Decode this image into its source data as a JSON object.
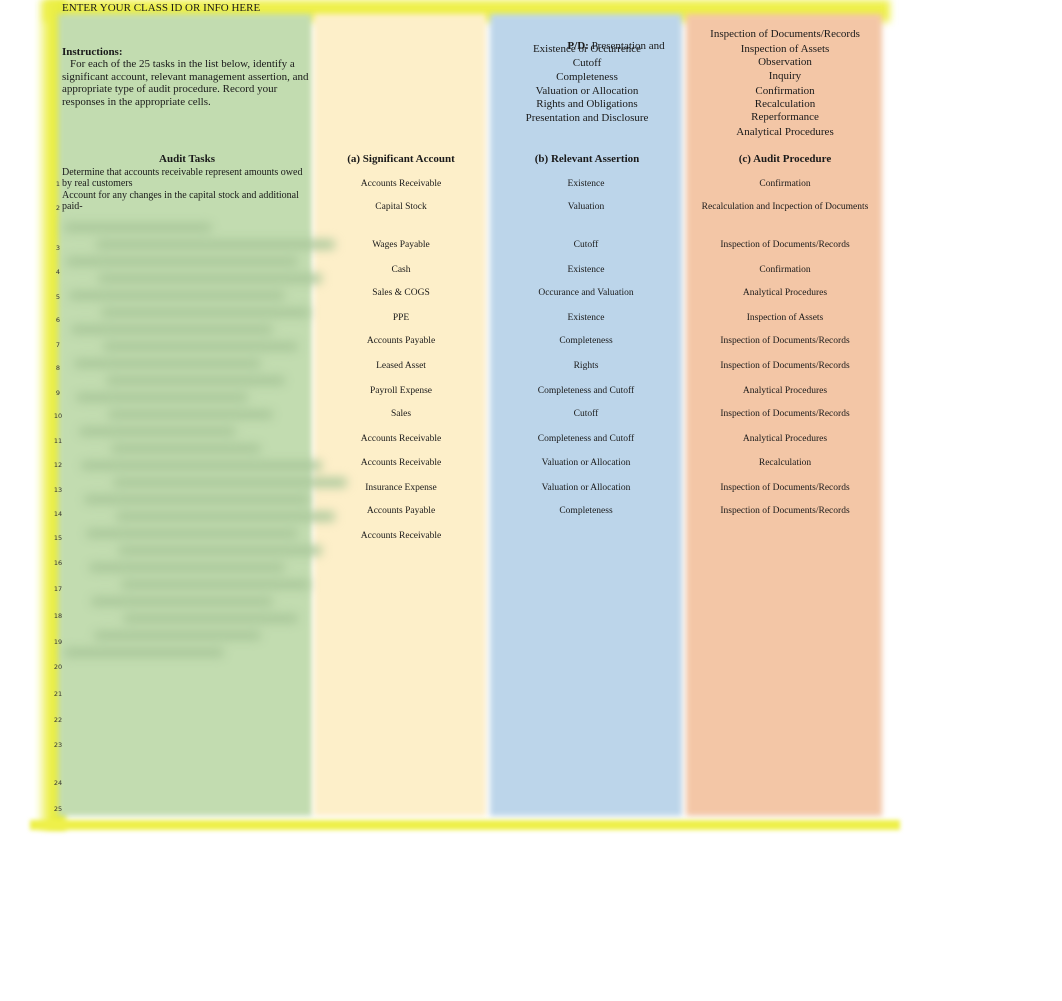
{
  "header": {
    "class_id_prompt": "ENTER YOUR CLASS ID OR INFO HERE"
  },
  "instructions": {
    "title": "Instructions:",
    "body": "For each of the 25 tasks in the list below, identify a significant account, relevant management assertion, and appropriate type of audit procedure. Record your responses in the appropriate cells."
  },
  "assertion_legend": {
    "overlay_label_bold": "P/D:",
    "overlay_label_rest": "Presentation and",
    "items": [
      "Existence or Occurrence",
      "Cutoff",
      "Completeness",
      "Valuation or Allocation",
      "Rights and Obligations",
      "Presentation and Disclosure"
    ]
  },
  "procedure_legend": {
    "items": [
      "Inspection of Documents/Records",
      "Inspection of Assets",
      "Observation",
      "Inquiry",
      "Confirmation",
      "Recalculation",
      "Reperformance",
      "Analytical Procedures"
    ]
  },
  "table": {
    "headers": {
      "tasks": "Audit Tasks",
      "account": "(a) Significant Account",
      "assertion": "(b) Relevant Assertion",
      "procedure": "(c) Audit Procedure"
    },
    "rows": [
      {
        "num": "1",
        "task": "Determine that accounts receivable represent amounts owed by real customers",
        "account": "Accounts Receivable",
        "assertion": "Existence",
        "procedure": "Confirmation"
      },
      {
        "num": "2",
        "task": "Account for any changes in the capital stock and additional paid-",
        "account": "Capital Stock",
        "assertion": "Valuation",
        "procedure": "Recalculation and Incpection of Documents"
      },
      {
        "num": "3",
        "task": "",
        "account": "Wages Payable",
        "assertion": "Cutoff",
        "procedure": "Inspection of Documents/Records"
      },
      {
        "num": "4",
        "task": "",
        "account": "Cash",
        "assertion": "Existence",
        "procedure": "Confirmation"
      },
      {
        "num": "5",
        "task": "",
        "account": "Sales & COGS",
        "assertion": "Occurance and Valuation",
        "procedure": "Analytical Procedures"
      },
      {
        "num": "6",
        "task": "",
        "account": "PPE",
        "assertion": "Existence",
        "procedure": "Inspection of Assets"
      },
      {
        "num": "7",
        "task": "",
        "account": "Accounts Payable",
        "assertion": "Completeness",
        "procedure": "Inspection of Documents/Records"
      },
      {
        "num": "8",
        "task": "",
        "account": "Leased Asset",
        "assertion": "Rights",
        "procedure": "Inspection of Documents/Records"
      },
      {
        "num": "9",
        "task": "",
        "account": "Payroll Expense",
        "assertion": "Completeness and Cutoff",
        "procedure": "Analytical Procedures"
      },
      {
        "num": "10",
        "task": "",
        "account": "Sales",
        "assertion": "Cutoff",
        "procedure": "Inspection of Documents/Records"
      },
      {
        "num": "11",
        "task": "",
        "account": "Accounts Receivable",
        "assertion": "Completeness and Cutoff",
        "procedure": "Analytical Procedures"
      },
      {
        "num": "12",
        "task": "",
        "account": "Accounts Receivable",
        "assertion": "Valuation or Allocation",
        "procedure": "Recalculation"
      },
      {
        "num": "13",
        "task": "",
        "account": "Insurance Expense",
        "assertion": "Valuation or Allocation",
        "procedure": "Inspection of Documents/Records"
      },
      {
        "num": "14",
        "task": "",
        "account": "Accounts Payable",
        "assertion": "Completeness",
        "procedure": "Inspection of Documents/Records"
      },
      {
        "num": "15",
        "task": "",
        "account": "Accounts Receivable",
        "assertion": "",
        "procedure": ""
      },
      {
        "num": "16",
        "task": "",
        "account": "",
        "assertion": "",
        "procedure": ""
      },
      {
        "num": "17",
        "task": "",
        "account": "",
        "assertion": "",
        "procedure": ""
      },
      {
        "num": "18",
        "task": "",
        "account": "",
        "assertion": "",
        "procedure": ""
      },
      {
        "num": "19",
        "task": "",
        "account": "",
        "assertion": "",
        "procedure": ""
      },
      {
        "num": "20",
        "task": "",
        "account": "",
        "assertion": "",
        "procedure": ""
      },
      {
        "num": "21",
        "task": "",
        "account": "",
        "assertion": "",
        "procedure": ""
      },
      {
        "num": "22",
        "task": "",
        "account": "",
        "assertion": "",
        "procedure": ""
      },
      {
        "num": "23",
        "task": "",
        "account": "",
        "assertion": "",
        "procedure": ""
      },
      {
        "num": "24",
        "task": "",
        "account": "",
        "assertion": "",
        "procedure": ""
      },
      {
        "num": "25",
        "task": "",
        "account": "",
        "assertion": "",
        "procedure": ""
      }
    ]
  }
}
